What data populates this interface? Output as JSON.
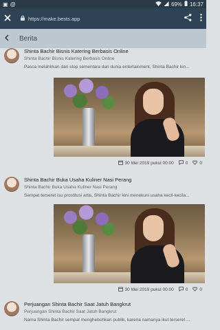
{
  "status": {
    "battery": "69%",
    "time": "16:37"
  },
  "browser": {
    "url": "https://make.bests.app"
  },
  "appbar": {
    "title": "Berita"
  },
  "posts": [
    {
      "title": "Shinta Bachir Bisnis Katering Berbasis Online",
      "subtitle": "Shinta Bachir Bisnis Katering Berbasis Online",
      "excerpt": "Pasca melahirkan dan stop sementara dari dunia entertainment, Shinta Bachir kin...",
      "date": "30 Mei 2019 pukul 00:00",
      "comments": "0",
      "likes": "0"
    },
    {
      "title": "Shinta Bachir Buka Usaha Kuliner Nasi Perang",
      "subtitle": "Shinta Bachir Buka Usaha Kuliner Nasi Perang",
      "excerpt": "Sempat terseret isu prostitusi artis, Shinta Bachir kini menekuni usaha kecil-kecila...",
      "date": "30 Mei 2019 pukul 00:00",
      "comments": "0",
      "likes": "0"
    },
    {
      "title": "Perjuangan Shinta Bachir Saat Jatuh Bangkrut",
      "subtitle": "Perjuangan Shinta Bachir Saat Jatuh Bangkrut",
      "excerpt": "Nama Shinta Bachir sempat menghebohkan publik, karena namanya ikut terseret ..."
    }
  ]
}
